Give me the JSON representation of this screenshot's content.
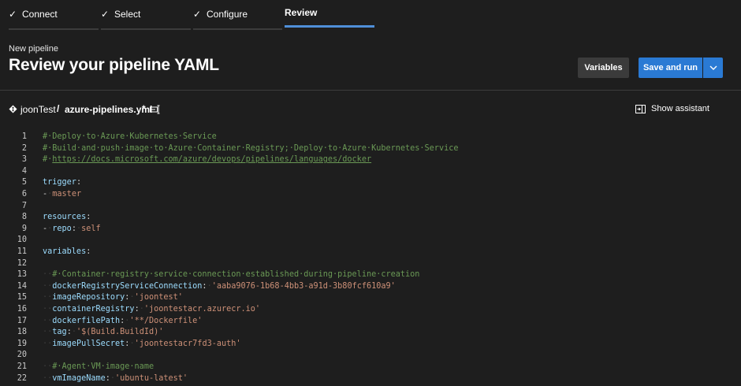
{
  "steps": [
    {
      "label": "Connect",
      "done": true
    },
    {
      "label": "Select",
      "done": true
    },
    {
      "label": "Configure",
      "done": true
    },
    {
      "label": "Review",
      "done": false,
      "active": true
    }
  ],
  "header": {
    "subtitle": "New pipeline",
    "title": "Review your pipeline YAML",
    "variables_label": "Variables",
    "save_label": "Save and run"
  },
  "filebar": {
    "repo": "joonTest",
    "separator": "/",
    "file": "azure-pipelines.yml",
    "modified": "*",
    "assistant_label": "Show assistant"
  },
  "colors": {
    "accent": "#2a7ad4",
    "active_tab": "#4f8fd8",
    "background": "#1e1e1e",
    "comment": "#6a9955",
    "key": "#9cdcfe",
    "string": "#ce9178"
  },
  "code": [
    {
      "n": "1",
      "t": [
        [
          "c",
          "#·Deploy·to·Azure·Kubernetes·Service"
        ]
      ]
    },
    {
      "n": "2",
      "t": [
        [
          "c",
          "#·Build·and·push·image·to·Azure·Container·Registry;·Deploy·to·Azure·Kubernetes·Service"
        ]
      ]
    },
    {
      "n": "3",
      "t": [
        [
          "c",
          "#·"
        ],
        [
          "u",
          "https://docs.microsoft.com/azure/devops/pipelines/languages/docker"
        ]
      ]
    },
    {
      "n": "4",
      "t": []
    },
    {
      "n": "5",
      "t": [
        [
          "k",
          "trigger"
        ],
        [
          "p",
          ":"
        ]
      ]
    },
    {
      "n": "6",
      "t": [
        [
          "p",
          "-"
        ],
        [
          "ws",
          "·"
        ],
        [
          "s",
          "master"
        ]
      ]
    },
    {
      "n": "7",
      "t": []
    },
    {
      "n": "8",
      "t": [
        [
          "k",
          "resources"
        ],
        [
          "p",
          ":"
        ]
      ]
    },
    {
      "n": "9",
      "t": [
        [
          "p",
          "-"
        ],
        [
          "ws",
          "·"
        ],
        [
          "k",
          "repo"
        ],
        [
          "p",
          ":"
        ],
        [
          "ws",
          "·"
        ],
        [
          "s",
          "self"
        ]
      ]
    },
    {
      "n": "10",
      "t": []
    },
    {
      "n": "11",
      "t": [
        [
          "k",
          "variables"
        ],
        [
          "p",
          ":"
        ]
      ]
    },
    {
      "n": "12",
      "t": []
    },
    {
      "n": "13",
      "t": [
        [
          "ws",
          "··"
        ],
        [
          "c",
          "#·Container·registry·service·connection·established·during·pipeline·creation"
        ]
      ]
    },
    {
      "n": "14",
      "t": [
        [
          "ws",
          "··"
        ],
        [
          "k",
          "dockerRegistryServiceConnection"
        ],
        [
          "p",
          ":"
        ],
        [
          "ws",
          "·"
        ],
        [
          "s",
          "'aaba9076-1b68-4bb3-a91d-3b80fcf610a9'"
        ]
      ]
    },
    {
      "n": "15",
      "t": [
        [
          "ws",
          "··"
        ],
        [
          "k",
          "imageRepository"
        ],
        [
          "p",
          ":"
        ],
        [
          "ws",
          "·"
        ],
        [
          "s",
          "'joontest'"
        ]
      ]
    },
    {
      "n": "16",
      "t": [
        [
          "ws",
          "··"
        ],
        [
          "k",
          "containerRegistry"
        ],
        [
          "p",
          ":"
        ],
        [
          "ws",
          "·"
        ],
        [
          "s",
          "'joontestacr.azurecr.io'"
        ]
      ]
    },
    {
      "n": "17",
      "t": [
        [
          "ws",
          "··"
        ],
        [
          "k",
          "dockerfilePath"
        ],
        [
          "p",
          ":"
        ],
        [
          "ws",
          "·"
        ],
        [
          "s",
          "'**/Dockerfile'"
        ]
      ]
    },
    {
      "n": "18",
      "t": [
        [
          "ws",
          "··"
        ],
        [
          "k",
          "tag"
        ],
        [
          "p",
          ":"
        ],
        [
          "ws",
          "·"
        ],
        [
          "s",
          "'$(Build.BuildId)'"
        ]
      ]
    },
    {
      "n": "19",
      "t": [
        [
          "ws",
          "··"
        ],
        [
          "k",
          "imagePullSecret"
        ],
        [
          "p",
          ":"
        ],
        [
          "ws",
          "·"
        ],
        [
          "s",
          "'joontestacr7fd3-auth'"
        ]
      ]
    },
    {
      "n": "20",
      "t": []
    },
    {
      "n": "21",
      "t": [
        [
          "ws",
          "··"
        ],
        [
          "c",
          "#·Agent·VM·image·name"
        ]
      ]
    },
    {
      "n": "22",
      "t": [
        [
          "ws",
          "··"
        ],
        [
          "k",
          "vmImageName"
        ],
        [
          "p",
          ":"
        ],
        [
          "ws",
          "·"
        ],
        [
          "s",
          "'ubuntu-latest'"
        ]
      ]
    }
  ]
}
